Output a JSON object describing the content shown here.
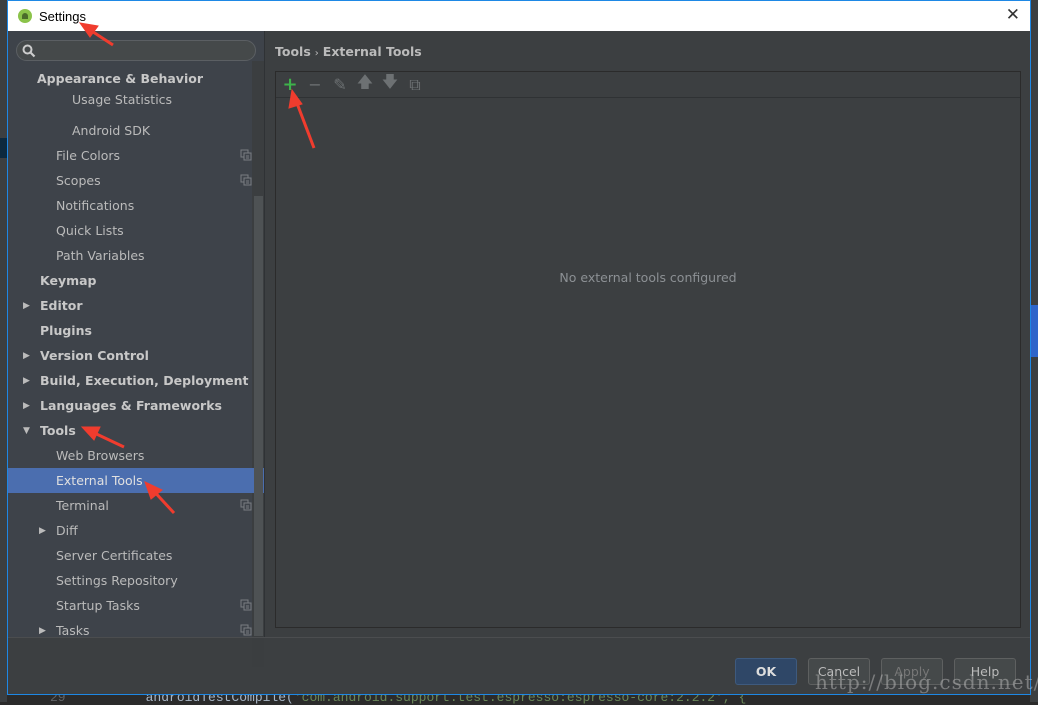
{
  "window": {
    "title": "Settings",
    "close_icon": "close-icon"
  },
  "search": {
    "placeholder": "",
    "value": ""
  },
  "sidebar": {
    "items": [
      {
        "label": "Appearance & Behavior",
        "bold": true,
        "indent": 0,
        "arrow": "none"
      },
      {
        "label": "Usage Statistics",
        "indent": 3
      },
      {
        "label": "Android SDK",
        "indent": 3
      },
      {
        "label": "File Colors",
        "indent": 2,
        "copy_icon": true
      },
      {
        "label": "Scopes",
        "indent": 2,
        "copy_icon": true
      },
      {
        "label": "Notifications",
        "indent": 2
      },
      {
        "label": "Quick Lists",
        "indent": 2
      },
      {
        "label": "Path Variables",
        "indent": 2
      },
      {
        "label": "Keymap",
        "bold": true,
        "indent": 1
      },
      {
        "label": "Editor",
        "bold": true,
        "indent": 1,
        "arrow": "right"
      },
      {
        "label": "Plugins",
        "bold": true,
        "indent": 1
      },
      {
        "label": "Version Control",
        "bold": true,
        "indent": 1,
        "arrow": "right"
      },
      {
        "label": "Build, Execution, Deployment",
        "bold": true,
        "indent": 1,
        "arrow": "right"
      },
      {
        "label": "Languages & Frameworks",
        "bold": true,
        "indent": 1,
        "arrow": "right"
      },
      {
        "label": "Tools",
        "bold": true,
        "indent": 1,
        "arrow": "down"
      },
      {
        "label": "Web Browsers",
        "indent": 2
      },
      {
        "label": "External Tools",
        "indent": 2,
        "selected": true
      },
      {
        "label": "Terminal",
        "indent": 2,
        "copy_icon": true
      },
      {
        "label": "Diff",
        "indent": 2,
        "arrow": "right"
      },
      {
        "label": "Server Certificates",
        "indent": 2
      },
      {
        "label": "Settings Repository",
        "indent": 2
      },
      {
        "label": "Startup Tasks",
        "indent": 2,
        "copy_icon": true
      },
      {
        "label": "Tasks",
        "indent": 2,
        "arrow": "right",
        "copy_icon": true
      }
    ]
  },
  "breadcrumb": {
    "parent": "Tools",
    "separator": "›",
    "current": "External Tools"
  },
  "toolbar": {
    "icons": [
      "add-icon",
      "remove-icon",
      "edit-icon",
      "move-up-icon",
      "move-down-icon",
      "copy-icon"
    ]
  },
  "empty_text": "No external tools configured",
  "buttons": {
    "ok": "OK",
    "cancel": "Cancel",
    "apply": "Apply",
    "help": "Help"
  },
  "background_code": {
    "line_number": "29",
    "text": "androidTestCompile(",
    "string": "'com.android.support.test.espresso:espresso-core:2.2.2', {"
  },
  "watermark": "http://blog.csdn.net/",
  "colors": {
    "selection": "#4b6eaf",
    "add_icon": "#3eb24b",
    "ok_button": "#2f4767",
    "annotation_arrow": "#f03c2e"
  }
}
